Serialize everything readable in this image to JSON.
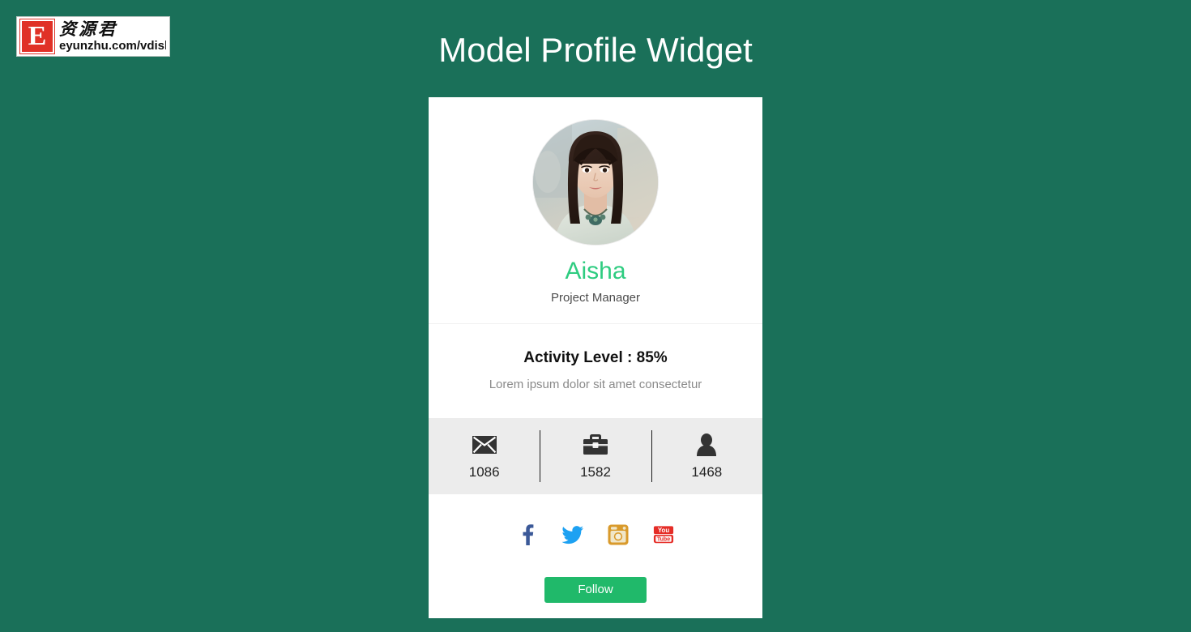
{
  "page": {
    "title": "Model Profile Widget",
    "background_color": "#1a7059"
  },
  "watermark": {
    "badge_letter": "E",
    "chinese_text": "资源君",
    "url_text": "eyunzhu.com/vdisk",
    "badge_color": "#e03127"
  },
  "card": {
    "avatar": {
      "icon": "avatar-photo",
      "alt": "portrait photo of a woman with long dark hair"
    },
    "name": "Aisha",
    "name_color": "#2ecc80",
    "role": "Project Manager",
    "activity": {
      "title": "Activity Level : 85%",
      "percent": "85%",
      "description": "Lorem ipsum dolor sit amet consectetur"
    },
    "stats": [
      {
        "icon": "envelope-icon",
        "value": "1086"
      },
      {
        "icon": "briefcase-icon",
        "value": "1582"
      },
      {
        "icon": "user-icon",
        "value": "1468"
      }
    ],
    "social": [
      {
        "icon": "facebook-icon",
        "label": "Facebook",
        "color": "#3b5998"
      },
      {
        "icon": "twitter-icon",
        "label": "Twitter",
        "color": "#1da1f2"
      },
      {
        "icon": "instagram-icon",
        "label": "Instagram",
        "color": "#d99a2b"
      },
      {
        "icon": "youtube-icon",
        "label": "YouTube",
        "color": "#e52d27"
      }
    ],
    "follow_label": "Follow",
    "follow_color": "#20b96a"
  }
}
